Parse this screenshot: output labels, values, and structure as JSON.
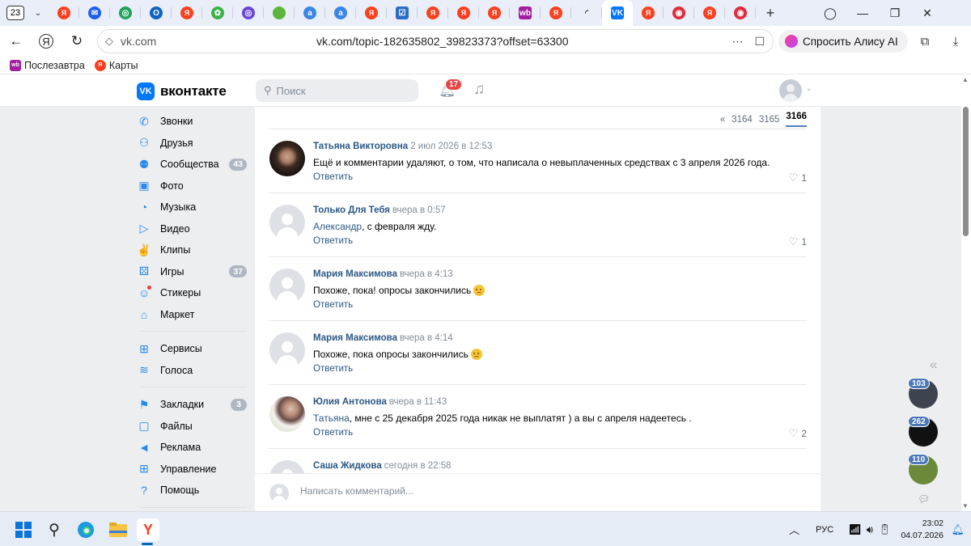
{
  "browser": {
    "tab_count": "23",
    "url_domain": "vk.com",
    "url_full": "vk.com/topic-182635802_39823373?offset=63300",
    "alice_label": "Спросить Алису AI",
    "bookmarks": [
      {
        "label": "Послезавтра",
        "icon": "wb-icon",
        "color": "#a21fa0"
      },
      {
        "label": "Карты",
        "icon": "yandex-maps-icon",
        "color": "#fc3f1d"
      }
    ],
    "tabs": [
      {
        "icon": "yandex-icon",
        "color": "#fc3f1d",
        "glyph": "Я"
      },
      {
        "icon": "mail-icon",
        "color": "#1e5ef3",
        "glyph": "✉"
      },
      {
        "icon": "map-pin-icon",
        "color": "#20a35a",
        "glyph": "◎"
      },
      {
        "icon": "outlook-icon",
        "color": "#0f62c2",
        "glyph": "O"
      },
      {
        "icon": "yandex-icon",
        "color": "#fc3f1d",
        "glyph": "Я"
      },
      {
        "icon": "chat-icon",
        "color": "#3bb34a",
        "glyph": "✿"
      },
      {
        "icon": "target-icon",
        "color": "#6a48d7",
        "glyph": "◎"
      },
      {
        "icon": "green-circle-icon",
        "color": "#5bb53a",
        "glyph": ""
      },
      {
        "icon": "a-icon",
        "color": "#3a86e8",
        "glyph": "a"
      },
      {
        "icon": "a-icon",
        "color": "#3a86e8",
        "glyph": "a"
      },
      {
        "icon": "yandex-icon",
        "color": "#fc3f1d",
        "glyph": "Я"
      },
      {
        "icon": "checkbox-icon",
        "color": "#2b6cc4",
        "glyph": "☑"
      },
      {
        "icon": "yandex-icon",
        "color": "#fc3f1d",
        "glyph": "Я"
      },
      {
        "icon": "yandex-icon",
        "color": "#fc3f1d",
        "glyph": "Я"
      },
      {
        "icon": "yandex-icon",
        "color": "#fc3f1d",
        "glyph": "Я"
      },
      {
        "icon": "wb-icon",
        "color": "#a21fa0",
        "glyph": "wb"
      },
      {
        "icon": "yandex-icon",
        "color": "#fc3f1d",
        "glyph": "Я"
      },
      {
        "icon": "loading-icon",
        "color": "#333333",
        "glyph": "◜"
      },
      {
        "icon": "vk-icon",
        "color": "#0077ff",
        "glyph": "VK",
        "active": true
      },
      {
        "icon": "yandex-icon",
        "color": "#fc3f1d",
        "glyph": "Я"
      },
      {
        "icon": "music-icon",
        "color": "#e02b3a",
        "glyph": "◉"
      },
      {
        "icon": "yandex-icon",
        "color": "#fc3f1d",
        "glyph": "Я"
      },
      {
        "icon": "music-icon",
        "color": "#e02b3a",
        "glyph": "◉"
      }
    ]
  },
  "vk": {
    "logo_text": "вконтакте",
    "search_placeholder": "Поиск",
    "notifications_count": "17",
    "sidebar": [
      {
        "label": "Звонки",
        "icon": "phone-icon",
        "glyph": "✆"
      },
      {
        "label": "Друзья",
        "icon": "friends-icon",
        "glyph": "⚇"
      },
      {
        "label": "Сообщества",
        "icon": "communities-icon",
        "glyph": "⚉",
        "badge": "43"
      },
      {
        "label": "Фото",
        "icon": "photo-icon",
        "glyph": "▣"
      },
      {
        "label": "Музыка",
        "icon": "music-icon",
        "glyph": "◔"
      },
      {
        "label": "Видео",
        "icon": "video-icon",
        "glyph": "▷"
      },
      {
        "label": "Клипы",
        "icon": "clips-icon",
        "glyph": "✌"
      },
      {
        "label": "Игры",
        "icon": "games-icon",
        "glyph": "⚄",
        "badge": "37"
      },
      {
        "label": "Стикеры",
        "icon": "stickers-icon",
        "glyph": "☺",
        "dot": true
      },
      {
        "label": "Маркет",
        "icon": "market-icon",
        "glyph": "⌂",
        "sep_after": true
      },
      {
        "label": "Сервисы",
        "icon": "services-icon",
        "glyph": "⊞"
      },
      {
        "label": "Голоса",
        "icon": "votes-icon",
        "glyph": "≋",
        "sep_after": true
      },
      {
        "label": "Закладки",
        "icon": "bookmark-icon",
        "glyph": "⚑",
        "badge": "3"
      },
      {
        "label": "Файлы",
        "icon": "files-icon",
        "glyph": "▢"
      },
      {
        "label": "Реклама",
        "icon": "ads-icon",
        "glyph": "◄"
      },
      {
        "label": "Управление",
        "icon": "manage-icon",
        "glyph": "⊞"
      },
      {
        "label": "Помощь",
        "icon": "help-icon",
        "glyph": "?",
        "sep_after": true
      }
    ],
    "pager": {
      "prev": "«",
      "pages": [
        "3164",
        "3165"
      ],
      "current": "3166"
    },
    "comments": [
      {
        "author": "Татьяна Викторовна",
        "date": "2 июл 2026 в 12:53",
        "mention": "",
        "text": "Ещё и комментарии удаляют, о том, что написала о невыплаченных средствах с 3 апреля 2026 года.",
        "emoji": false,
        "reply": "Ответить",
        "likes": "1",
        "avatar": "photo1"
      },
      {
        "author": "Только Для Тебя",
        "date": "вчера в 0:57",
        "mention": "Александр",
        "text": ", с февраля жду.",
        "emoji": false,
        "reply": "Ответить",
        "likes": "1",
        "avatar": "default"
      },
      {
        "author": "Мария Максимова",
        "date": "вчера в 4:13",
        "mention": "",
        "text": "Похоже, пока! опросы закончились",
        "emoji": true,
        "reply": "Ответить",
        "likes": "",
        "avatar": "default"
      },
      {
        "author": "Мария Максимова",
        "date": "вчера в 4:14",
        "mention": "",
        "text": "Похоже, пока опросы закончились",
        "emoji": true,
        "reply": "Ответить",
        "likes": "",
        "avatar": "default"
      },
      {
        "author": "Юлия Антонова",
        "date": "вчера в 11:43",
        "mention": "Татьяна",
        "text": ", мне с 25 декабря 2025 года никак не выплатят ) а вы с апреля надеетесь .",
        "emoji": false,
        "reply": "Ответить",
        "likes": "2",
        "avatar": "photo2"
      },
      {
        "author": "Саша Жидкова",
        "date": "сегодня в 22:58",
        "mention": "",
        "text": "",
        "emoji": false,
        "reply": "",
        "likes": "",
        "avatar": "default"
      }
    ],
    "composer_placeholder": "Написать комментарий...",
    "chats": [
      {
        "badge": "103",
        "color": "#3d4450"
      },
      {
        "badge": "262",
        "color": "#111111"
      },
      {
        "badge": "110",
        "color": "#6a8a3a"
      }
    ]
  },
  "taskbar": {
    "lang": "РУС",
    "time": "23:02",
    "date": "04.07.2026"
  }
}
